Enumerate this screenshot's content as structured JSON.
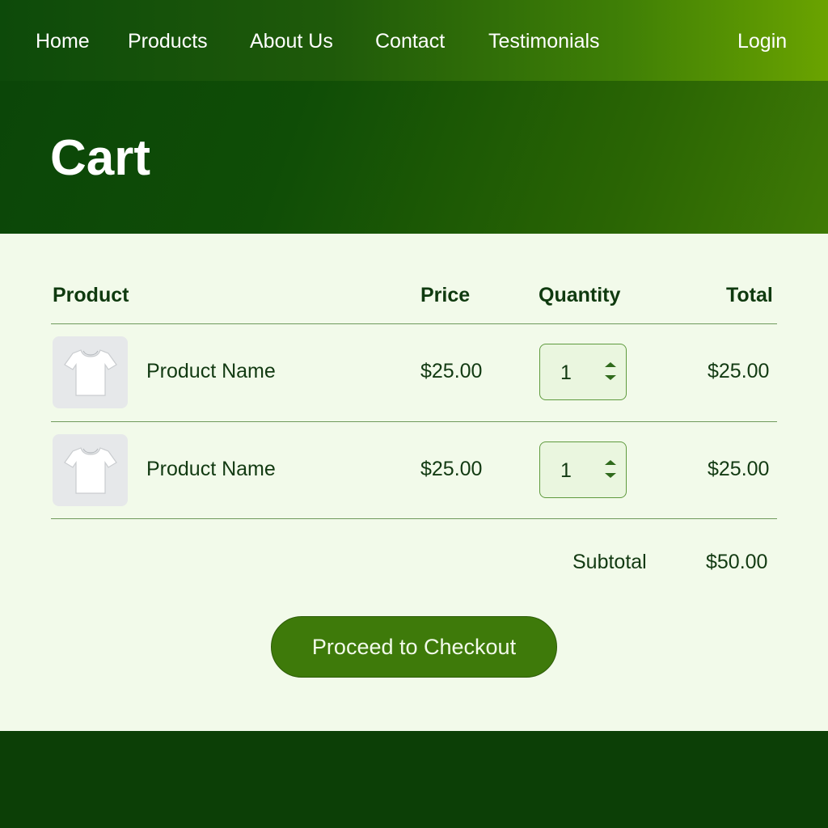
{
  "nav": {
    "items": [
      "Home",
      "Products",
      "About Us",
      "Contact",
      "Testimonials"
    ],
    "login": "Login"
  },
  "hero": {
    "title": "Cart"
  },
  "table": {
    "headers": {
      "product": "Product",
      "price": "Price",
      "quantity": "Quantity",
      "total": "Total"
    },
    "rows": [
      {
        "name": "Product Name",
        "price": "$25.00",
        "quantity": "1",
        "total": "$25.00",
        "image_icon": "tshirt-icon"
      },
      {
        "name": "Product Name",
        "price": "$25.00",
        "quantity": "1",
        "total": "$25.00",
        "image_icon": "tshirt-icon"
      }
    ]
  },
  "summary": {
    "subtotal_label": "Subtotal",
    "subtotal_value": "$50.00"
  },
  "checkout": {
    "label": "Proceed to Checkout"
  },
  "colors": {
    "nav_start": "#0d4a0a",
    "nav_end": "#6aa300",
    "hero": "#0f4d06",
    "page_bg": "#f2faea",
    "button": "#3e7a0a",
    "footer": "#0c3f06"
  }
}
